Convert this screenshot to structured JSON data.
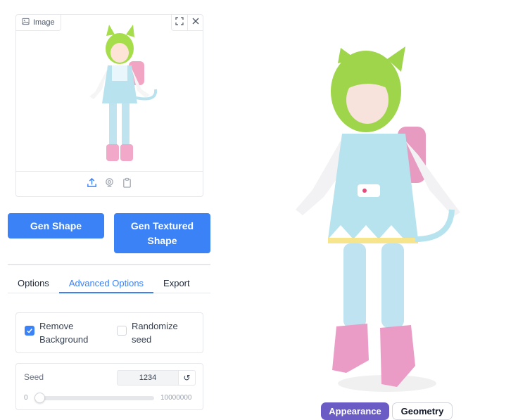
{
  "image_panel": {
    "label": "Image",
    "label_icon": "image-icon",
    "fullscreen_icon": "fullscreen-icon",
    "close_icon": "close-icon",
    "toolbar_icons": [
      "upload-icon",
      "webcam-icon",
      "clipboard-icon"
    ]
  },
  "actions": {
    "gen_shape": "Gen Shape",
    "gen_textured_shape": "Gen Textured Shape"
  },
  "tabs": [
    {
      "label": "Options",
      "active": false
    },
    {
      "label": "Advanced Options",
      "active": true
    },
    {
      "label": "Export",
      "active": false
    }
  ],
  "checkboxes": {
    "remove_background": {
      "label": "Remove Background",
      "checked": true
    },
    "randomize_seed": {
      "label": "Randomize seed",
      "checked": false
    }
  },
  "seed": {
    "label": "Seed",
    "value": "1234",
    "reset_icon": "↺",
    "min": "0",
    "max": "10000000"
  },
  "view_modes": {
    "appearance": "Appearance",
    "geometry": "Geometry",
    "active": "Appearance"
  },
  "colors": {
    "primary": "#3b82f6",
    "appearance_active": "#6a5cc4"
  }
}
